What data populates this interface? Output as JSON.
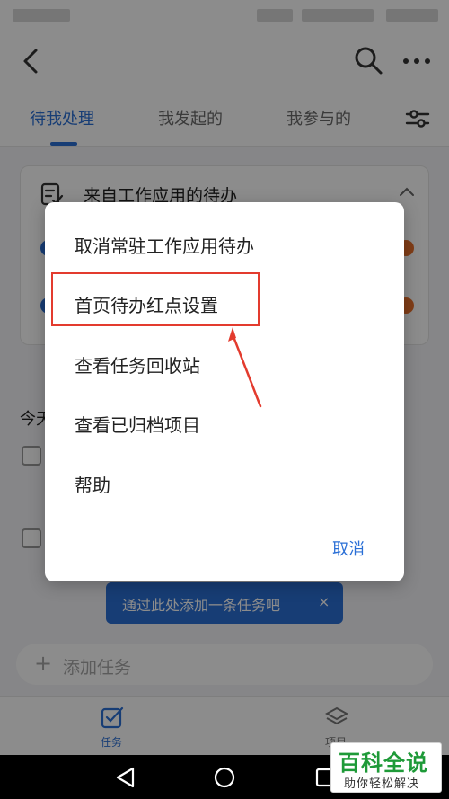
{
  "tabs": [
    {
      "label": "待我处理",
      "active": true
    },
    {
      "label": "我发起的",
      "active": false
    },
    {
      "label": "我参与的",
      "active": false
    }
  ],
  "card": {
    "title": "来自工作应用的待办"
  },
  "today_label": "今天",
  "hint": {
    "text": "通过此处添加一条任务吧",
    "close": "×"
  },
  "add_task": {
    "plus": "+",
    "placeholder": "添加任务"
  },
  "bottom_nav": [
    {
      "label": "任务",
      "icon": "checkbox-icon",
      "active": true
    },
    {
      "label": "项目",
      "icon": "layers-icon",
      "active": false
    }
  ],
  "dialog": {
    "items": [
      {
        "label": "取消常驻工作应用待办"
      },
      {
        "label": "首页待办红点设置"
      },
      {
        "label": "查看任务回收站"
      },
      {
        "label": "查看已归档项目"
      },
      {
        "label": "帮助"
      }
    ],
    "cancel": "取消"
  },
  "watermark": {
    "title": "百科全说",
    "subtitle": "助你轻松解决"
  },
  "colors": {
    "accent": "#2a6fd6",
    "annotation": "#e33b2e",
    "watermark": "#1e9a38"
  }
}
